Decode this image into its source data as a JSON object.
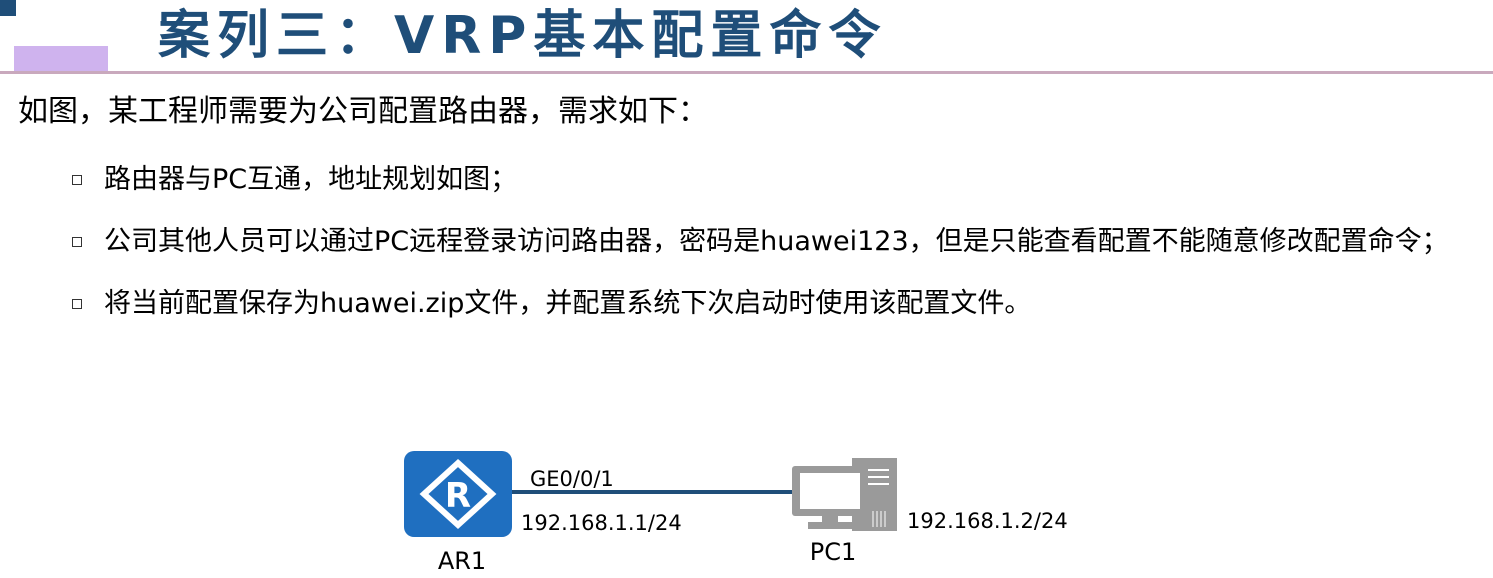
{
  "slide": {
    "title": "案列三：VRP基本配置命令",
    "intro": "如图，某工程师需要为公司配置路由器，需求如下：",
    "requirements": [
      "路由器与PC互通，地址规划如图；",
      "公司其他人员可以通过PC远程登录访问路由器，密码是huawei123，但是只能查看配置不能随意修改配置命令；",
      "将当前配置保存为huawei.zip文件，并配置系统下次启动时使用该配置文件。"
    ]
  },
  "diagram": {
    "router": {
      "label": "AR1",
      "icon_letter": "R",
      "icon": "router-icon"
    },
    "interface": {
      "name": "GE0/0/1",
      "ip": "192.168.1.1/24"
    },
    "pc": {
      "label": "PC1",
      "ip": "192.168.1.2/24",
      "icon": "pc-icon"
    },
    "colors": {
      "router": "#1f6fc0",
      "link": "#1f4e79",
      "pc": "#9a9a9a",
      "title": "#1f4e79"
    }
  }
}
